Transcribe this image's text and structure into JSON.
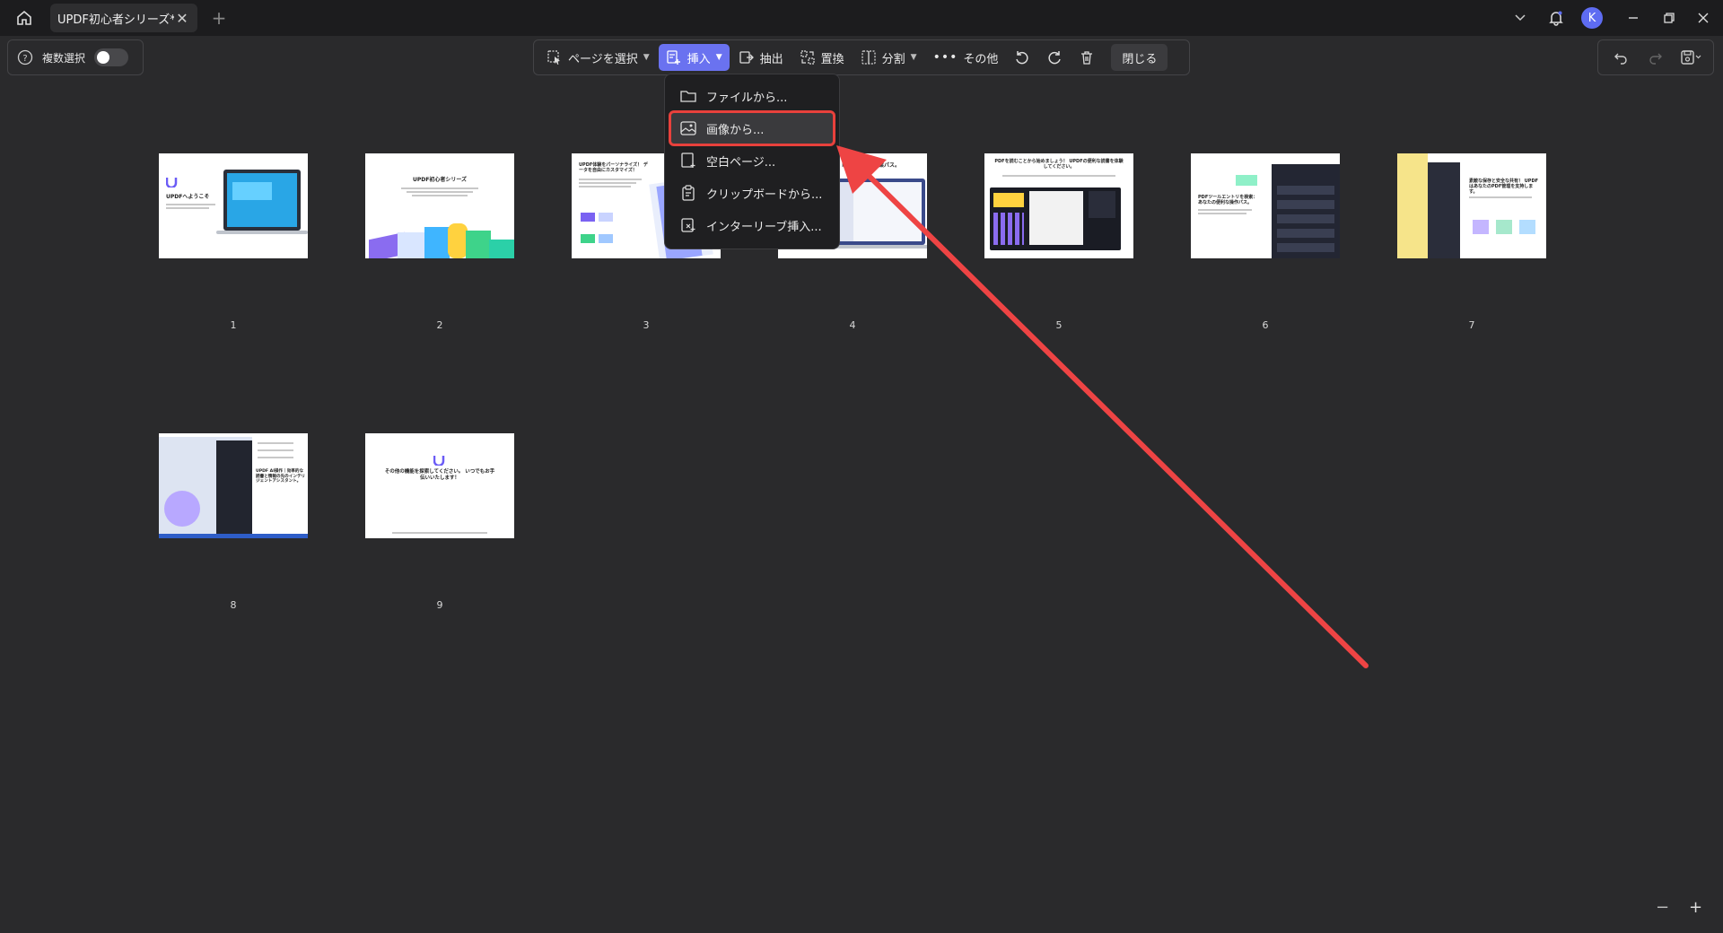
{
  "titlebar": {
    "tab_label": "UPDF初心者シリーズ*",
    "avatar_letter": "K"
  },
  "left_panel": {
    "multi_select_label": "複数選択"
  },
  "toolbar": {
    "select_pages": "ページを選択",
    "insert": "挿入",
    "extract": "抽出",
    "replace": "置換",
    "split": "分割",
    "more": "その他",
    "close": "閉じる"
  },
  "insert_menu": {
    "items": [
      {
        "label": "ファイルから...",
        "icon": "folder-icon"
      },
      {
        "label": "画像から...",
        "icon": "image-icon"
      },
      {
        "label": "空白ページ...",
        "icon": "blank-page-icon"
      },
      {
        "label": "クリップボードから...",
        "icon": "clipboard-icon"
      },
      {
        "label": "インターリーブ挿入...",
        "icon": "interleave-icon"
      }
    ],
    "highlighted_index": 1
  },
  "pages": [
    {
      "number": "1",
      "title": "UPDFへようこそ"
    },
    {
      "number": "2",
      "title": "UPDF初心者シリーズ"
    },
    {
      "number": "3",
      "title": "UPDF体験をパーソナライズ！ データを自由にカスタマイズ！"
    },
    {
      "number": "4",
      "title": "ドキュメント作業パス。"
    },
    {
      "number": "5",
      "title": "PDFを読むことから始めましょう！ UPDFの便利な読書を体験してください。"
    },
    {
      "number": "6",
      "title": "PDFツールエントリを検索： あなたの便利な操作パス。"
    },
    {
      "number": "7",
      "title": "素敵な保存と安全な共有！ UPDFはあなたのPDF管理を支持します。"
    },
    {
      "number": "8",
      "title": "UPDF AI操作｜効率的な読書と情報の先のインテリジェントアシスタント。"
    },
    {
      "number": "9",
      "title": "その他の機能を探索してください。 いつでもお手伝いいたします！"
    }
  ],
  "colors": {
    "accent": "#6a72f0",
    "highlight_border": "#e8413c",
    "arrow": "#ee4444",
    "background": "#2a2a2c"
  }
}
